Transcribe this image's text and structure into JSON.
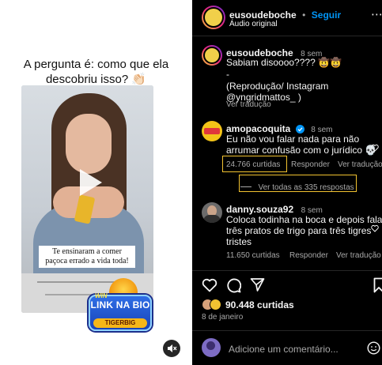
{
  "media": {
    "overlay_line1": "A pergunta é: como que ela",
    "overlay_line2": "descobriu isso? 👏🏻",
    "caption_line1": "Te ensinaram a comer",
    "caption_line2": "paçoca errado a vida toda!",
    "badge_win": "WIN",
    "badge_link": "LINK NA BIO",
    "badge_brand": "TIGERBIG"
  },
  "header": {
    "username": "eusoudeboche",
    "separator": "•",
    "follow_label": "Seguir",
    "audio_label": "Áudio original",
    "more_label": "⋯"
  },
  "caption": {
    "username": "eusoudeboche",
    "time": "8 sem",
    "line1": "Sabiam disoooo???? 🤠🤠",
    "line2": "-",
    "line3": "(Reprodução/ Instagram",
    "line4": "@yngridmattos_ )",
    "translation": "Ver tradução"
  },
  "comments": [
    {
      "username": "amopacoquita",
      "verified": true,
      "time": "8 sem",
      "line1": "Eu não vou falar nada para não",
      "line2": "arrumar confusão com o jurídico 💀",
      "likes": "24.766 curtidas",
      "reply": "Responder",
      "translation": "Ver tradução",
      "view_replies": "Ver todas as 335 respostas"
    },
    {
      "username": "danny.souza92",
      "time": "8 sem",
      "line1": "Coloca todinha na boca e depois fala",
      "line2": "três pratos de trigo para três tigres",
      "line3": "tristes",
      "likes": "11.650 curtidas",
      "reply": "Responder",
      "translation": "Ver tradução"
    }
  ],
  "actions": {
    "like_count": "90.448 curtidas",
    "date": "8 de janeiro"
  },
  "composer": {
    "placeholder": "Adicione um comentário..."
  },
  "colors": {
    "panel_bg": "#000000",
    "accent_blue": "#0095f6",
    "highlight": "#f2c230",
    "muted_text": "#a8a8a8"
  }
}
